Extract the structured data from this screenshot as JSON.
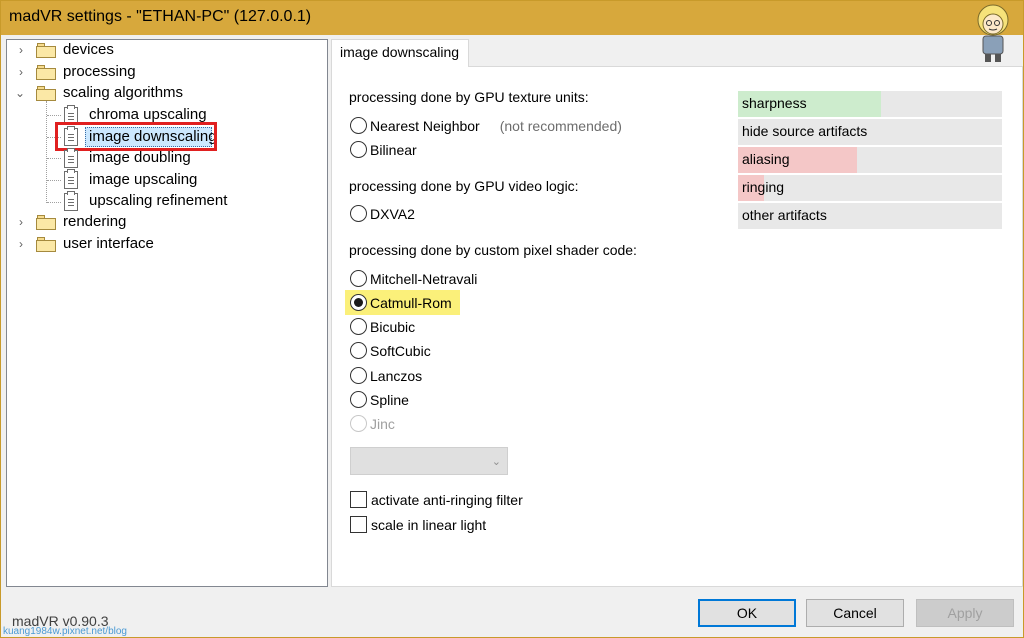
{
  "window": {
    "title": "madVR settings - \"ETHAN-PC\" (127.0.0.1)"
  },
  "tree": {
    "items": [
      {
        "label": "devices"
      },
      {
        "label": "processing"
      },
      {
        "label": "scaling algorithms"
      },
      {
        "label": "chroma upscaling"
      },
      {
        "label": "image downscaling"
      },
      {
        "label": "image doubling"
      },
      {
        "label": "image upscaling"
      },
      {
        "label": "upscaling refinement"
      },
      {
        "label": "rendering"
      },
      {
        "label": "user interface"
      }
    ]
  },
  "tab": {
    "label": "image downscaling"
  },
  "sections": {
    "gpu_texture": "processing done by GPU texture units:",
    "gpu_video": "processing done by GPU video logic:",
    "pixel_shader": "processing done by custom pixel shader code:"
  },
  "options": {
    "nearest": "Nearest Neighbor",
    "nearest_note": "(not recommended)",
    "bilinear": "Bilinear",
    "dxva2": "DXVA2",
    "mitchell": "Mitchell-Netravali",
    "catmull": "Catmull-Rom",
    "bicubic": "Bicubic",
    "softcubic": "SoftCubic",
    "lanczos": "Lanczos",
    "spline": "Spline",
    "jinc": "Jinc",
    "selected": "Catmull-Rom"
  },
  "checkboxes": {
    "anti_ringing": "activate anti-ringing filter",
    "linear_light": "scale in linear light"
  },
  "quality": {
    "items": [
      {
        "label": "sharpness",
        "level": 0.54,
        "color": "#cdeccd"
      },
      {
        "label": "hide source artifacts",
        "level": 0,
        "color": "#e8e8e8"
      },
      {
        "label": "aliasing",
        "level": 0.45,
        "color": "#f4c7c7"
      },
      {
        "label": "ringing",
        "level": 0.1,
        "color": "#f4c7c7"
      },
      {
        "label": "other artifacts",
        "level": 0,
        "color": "#e8e8e8"
      }
    ]
  },
  "footer": {
    "version": "madVR v0.90.3",
    "ok": "OK",
    "cancel": "Cancel",
    "apply": "Apply",
    "watermark": "kuang1984w.pixnet.net/blog"
  }
}
